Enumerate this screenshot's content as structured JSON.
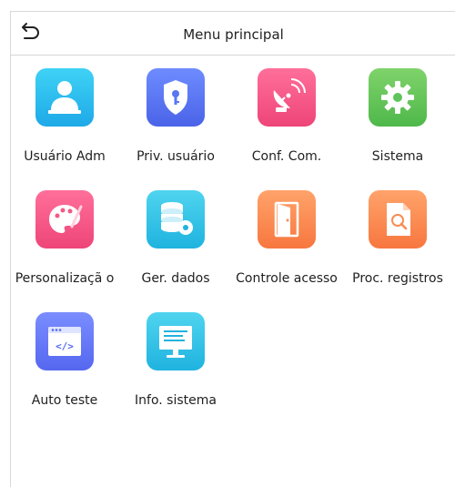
{
  "header": {
    "title": "Menu principal",
    "back_icon": "back-arrow-icon"
  },
  "menu": {
    "items": [
      {
        "label": "Usuário Adm",
        "icon": "user-admin-icon",
        "color": "#2bbbef"
      },
      {
        "label": "Priv. usuário",
        "icon": "shield-key-icon",
        "color": "#5a76f3"
      },
      {
        "label": "Conf. Com.",
        "icon": "satellite-dish-icon",
        "color": "#f35a85"
      },
      {
        "label": "Sistema",
        "icon": "gear-icon",
        "color": "#5fc45a"
      },
      {
        "label": "Personalizaçã o",
        "icon": "palette-icon",
        "color": "#f35a85"
      },
      {
        "label": "Ger. dados",
        "icon": "database-gear-icon",
        "color": "#2bbbef"
      },
      {
        "label": "Controle acesso",
        "icon": "door-icon",
        "color": "#f98c52"
      },
      {
        "label": "Proc. registros",
        "icon": "document-search-icon",
        "color": "#f98c52"
      },
      {
        "label": "Auto teste",
        "icon": "code-window-icon",
        "color": "#5a76f3"
      },
      {
        "label": "Info. sistema",
        "icon": "monitor-icon",
        "color": "#2bbbef"
      }
    ]
  }
}
